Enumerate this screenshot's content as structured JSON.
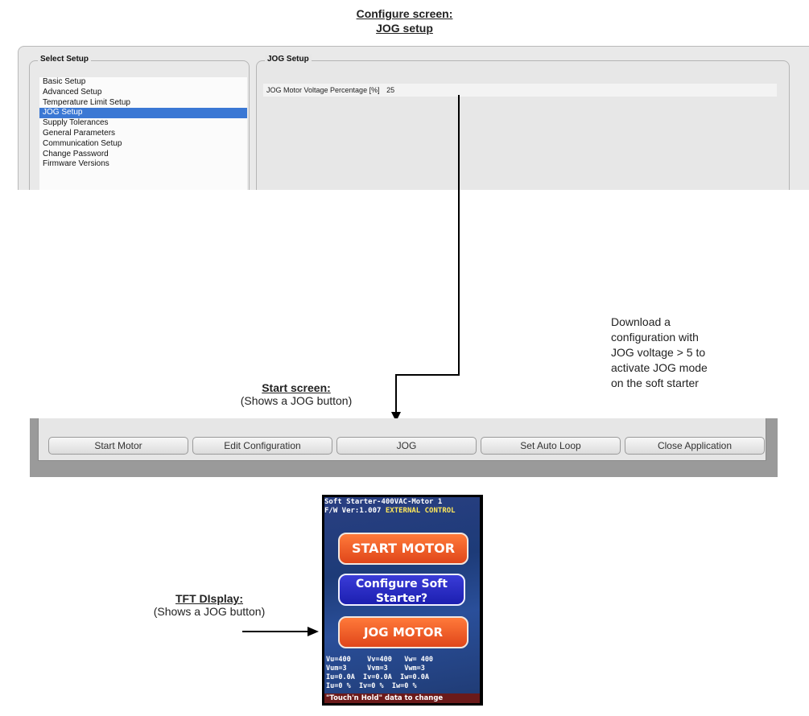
{
  "configure": {
    "title_line1": "Configure screen:",
    "title_line2": "JOG setup",
    "select_setup": {
      "title": "Select Setup",
      "items": [
        {
          "label": "Basic Setup"
        },
        {
          "label": "Advanced Setup"
        },
        {
          "label": "Temperature Limit Setup"
        },
        {
          "label": "JOG Setup"
        },
        {
          "label": "Supply Tolerances"
        },
        {
          "label": "General Parameters"
        },
        {
          "label": "Communication Setup"
        },
        {
          "label": "Change Password"
        },
        {
          "label": "Firmware Versions"
        }
      ],
      "selected": "JOG Setup"
    },
    "jog_setup": {
      "title": "JOG Setup",
      "field_label": "JOG Motor Voltage Percentage [%]",
      "field_value": "25"
    }
  },
  "note": {
    "lines": [
      "Download a",
      "configuration with",
      "JOG voltage > 5  to",
      "activate JOG mode",
      "on the soft starter"
    ]
  },
  "start_screen": {
    "title": "Start screen:",
    "subtitle": "(Shows a JOG button)",
    "buttons": [
      {
        "label": "Start Motor"
      },
      {
        "label": "Edit Configuration"
      },
      {
        "label": "JOG"
      },
      {
        "label": "Set Auto Loop"
      },
      {
        "label": "Close Application"
      }
    ]
  },
  "tft": {
    "caption_title": "TFT DIsplay:",
    "caption_subtitle": "(Shows a JOG button)",
    "header_line1": "Soft Starter-400VAC-Motor 1",
    "header_fw": "F/W Ver:1.007",
    "header_mode": "EXTERNAL CONTROL",
    "btn_start": "START MOTOR",
    "btn_configure_line1": "Configure Soft",
    "btn_configure_line2": "Starter?",
    "btn_jog": "JOG MOTOR",
    "data_lines": [
      "Vu=400    Vv=400   Vw= 400",
      "Vum=3     Vvm=3    Vwm=3",
      "Iu=0.0A  Iv=0.0A  Iw=0.0A",
      "Iu=0 %  Iv=0 %  Iw=0 %"
    ],
    "footer": "\"Touch'n Hold\" data to change"
  },
  "colors": {
    "selection": "#3b78d4",
    "tft_orange": "#e9572a",
    "tft_blue": "#2325c0",
    "tft_yellow": "#ffe85a"
  }
}
